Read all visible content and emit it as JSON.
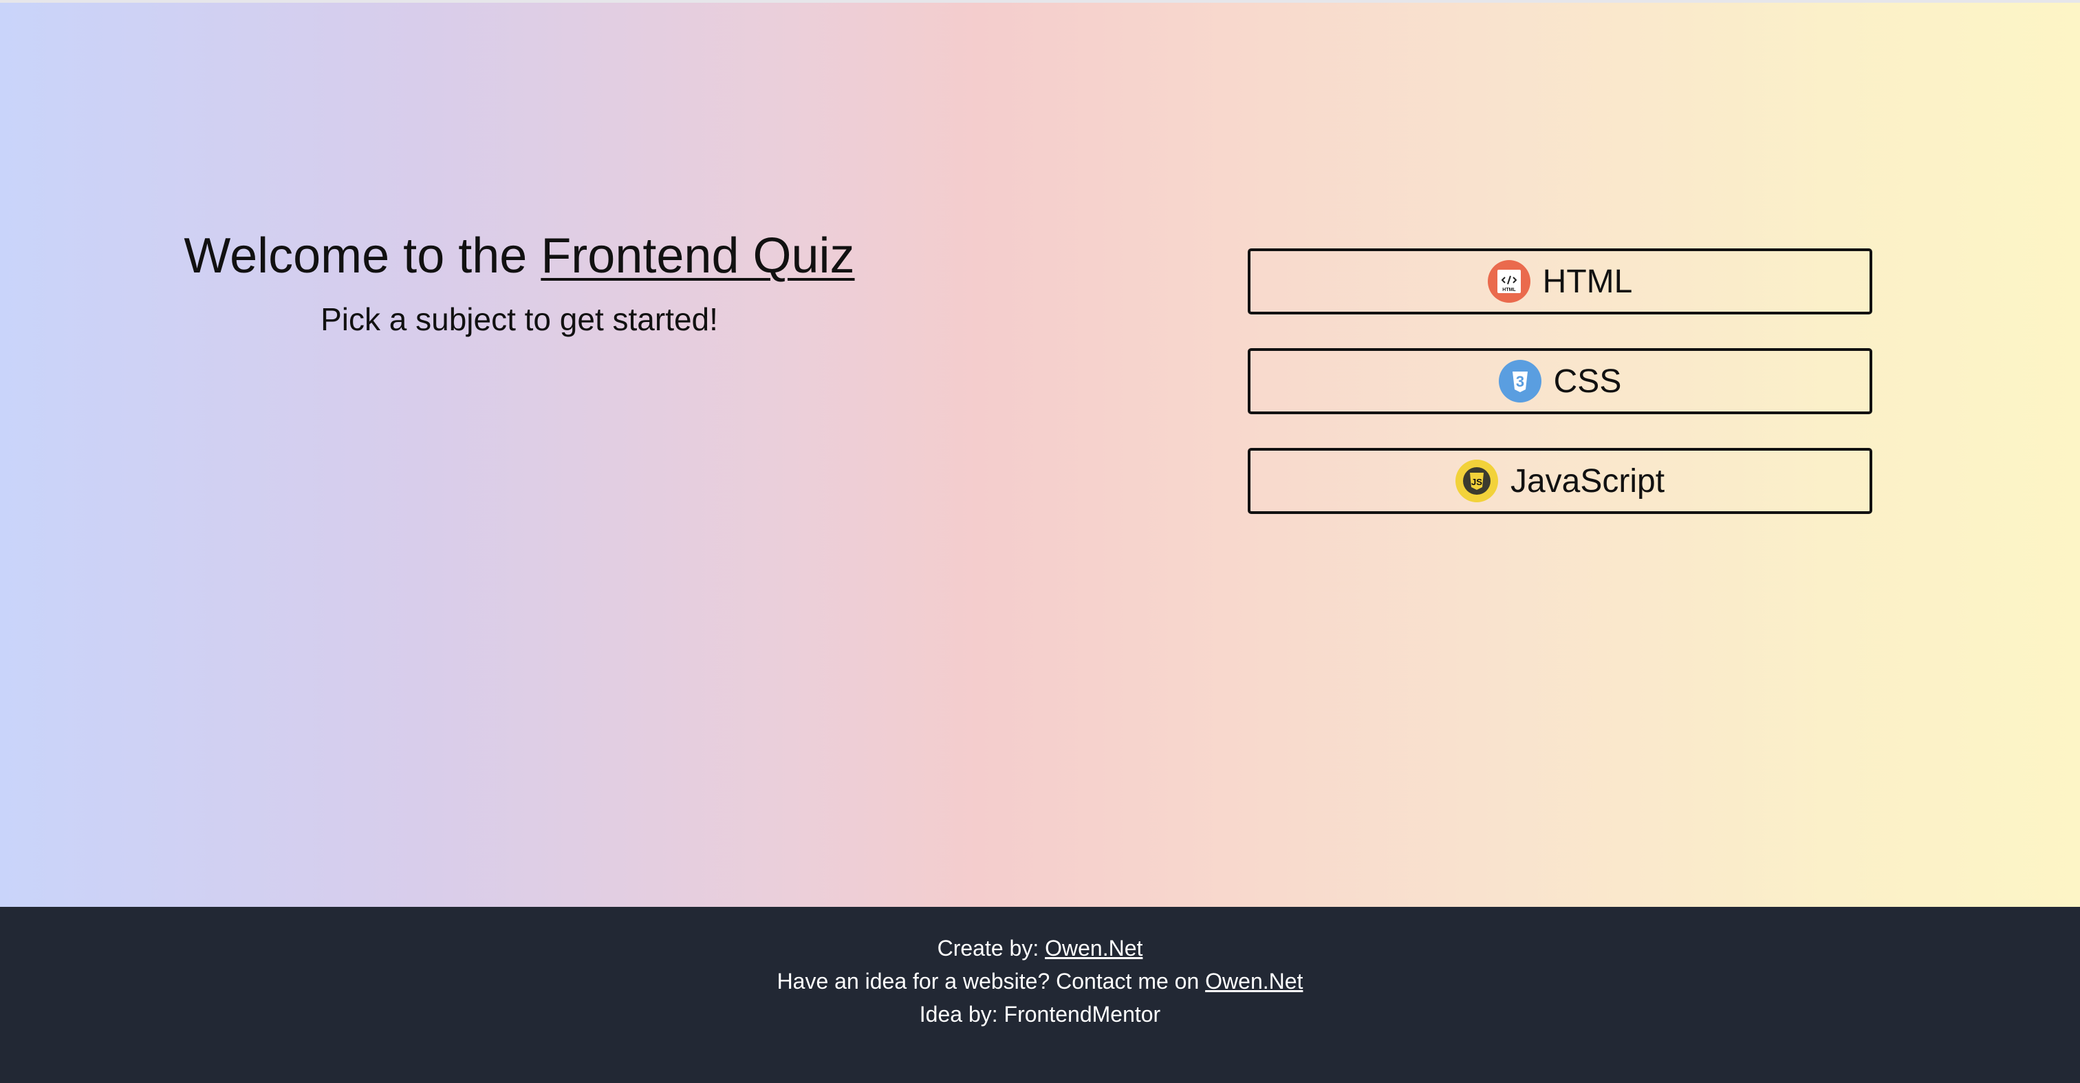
{
  "colors": {
    "footer_background": "#222834",
    "gradient_left": "#c9d4fa",
    "gradient_mid": "#f4cdcd",
    "gradient_right": "#fdf5c6",
    "html_icon": "#ea6a4d",
    "css_icon": "#5a9ee0",
    "js_icon": "#f2d23a"
  },
  "welcome": {
    "prefix": "Welcome to the ",
    "link_text": "Frontend Quiz",
    "subtitle": "Pick a subject to get started!"
  },
  "subjects": [
    {
      "label": "HTML",
      "icon": "html-icon",
      "icon_text": "HTML"
    },
    {
      "label": "CSS",
      "icon": "css-icon",
      "icon_text": "3"
    },
    {
      "label": "JavaScript",
      "icon": "javascript-icon",
      "icon_text": "JS"
    }
  ],
  "footer": {
    "created_by_prefix": "Create by: ",
    "created_by_link": "Owen.Net",
    "contact_prefix": "Have an idea for a website? Contact me on ",
    "contact_link": "Owen.Net",
    "idea_text": "Idea by: FrontendMentor"
  }
}
